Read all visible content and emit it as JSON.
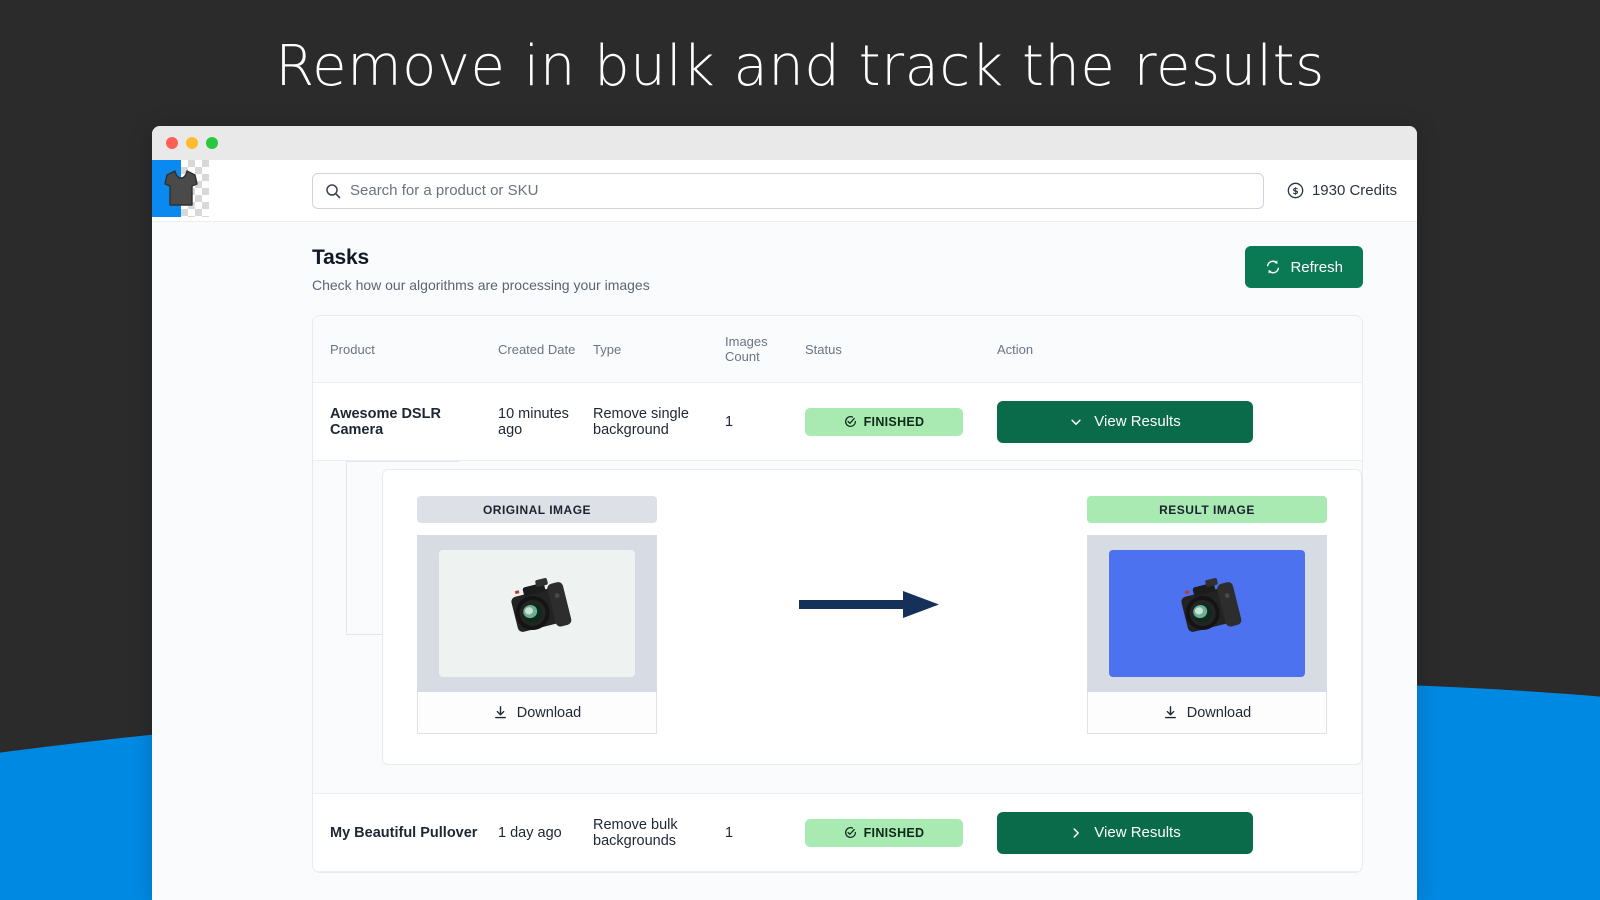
{
  "headline": "Remove in bulk and track the results",
  "theme": {
    "background": "#2b2b2b",
    "wave": "#0089e3",
    "accent_green": "#0a7a54",
    "badge_green": "#a9eab3",
    "result_blue": "#4d72f0",
    "logo_blue": "#0a8af0"
  },
  "window": {
    "titlebar": {
      "dots": [
        "close",
        "minimize",
        "maximize"
      ]
    },
    "appbar": {
      "logo_icon": "tshirt-logo-icon",
      "search": {
        "icon": "search-icon",
        "placeholder": "Search for a product or SKU",
        "value": ""
      },
      "credits": {
        "icon": "credit-coin-icon",
        "label": "1930 Credits"
      }
    }
  },
  "page": {
    "title": "Tasks",
    "subtitle": "Check how our algorithms are processing your images",
    "refresh": {
      "label": "Refresh",
      "icon": "refresh-icon"
    }
  },
  "table": {
    "columns": [
      "Product",
      "Created Date",
      "Type",
      "Images Count",
      "Status",
      "Action"
    ],
    "rows": [
      {
        "product": "Awesome DSLR Camera",
        "created_date": "10 minutes ago",
        "type": "Remove single background",
        "images_count": "1",
        "status": "FINISHED",
        "status_icon": "check-circle-icon",
        "action_label": "View Results",
        "action_icon": "chevron-down-icon",
        "expanded": true
      },
      {
        "product": "My Beautiful Pullover",
        "created_date": "1 day ago",
        "type": "Remove bulk backgrounds",
        "images_count": "1",
        "status": "FINISHED",
        "status_icon": "check-circle-icon",
        "action_label": "View Results",
        "action_icon": "chevron-right-icon",
        "expanded": false
      }
    ]
  },
  "detail": {
    "original": {
      "label": "ORIGINAL IMAGE",
      "image_alt": "dslr-camera-on-white-background",
      "download_label": "Download",
      "download_icon": "download-icon"
    },
    "arrow_icon": "arrow-right-icon",
    "result": {
      "label": "RESULT IMAGE",
      "image_alt": "dslr-camera-on-blue-background",
      "download_label": "Download",
      "download_icon": "download-icon"
    }
  }
}
